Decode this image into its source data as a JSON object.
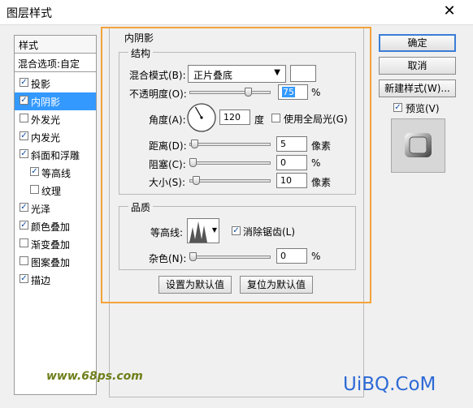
{
  "window": {
    "title": "图层样式"
  },
  "styles_list": {
    "header": "样式",
    "blend_options": "混合选项:自定",
    "items": [
      {
        "label": "投影",
        "checked": true,
        "selected": false,
        "indent": false
      },
      {
        "label": "内阴影",
        "checked": true,
        "selected": true,
        "indent": false
      },
      {
        "label": "外发光",
        "checked": false,
        "selected": false,
        "indent": false
      },
      {
        "label": "内发光",
        "checked": true,
        "selected": false,
        "indent": false
      },
      {
        "label": "斜面和浮雕",
        "checked": true,
        "selected": false,
        "indent": false
      },
      {
        "label": "等高线",
        "checked": true,
        "selected": false,
        "indent": true
      },
      {
        "label": "纹理",
        "checked": false,
        "selected": false,
        "indent": true
      },
      {
        "label": "光泽",
        "checked": true,
        "selected": false,
        "indent": false
      },
      {
        "label": "颜色叠加",
        "checked": true,
        "selected": false,
        "indent": false
      },
      {
        "label": "渐变叠加",
        "checked": false,
        "selected": false,
        "indent": false
      },
      {
        "label": "图案叠加",
        "checked": false,
        "selected": false,
        "indent": false
      },
      {
        "label": "描边",
        "checked": true,
        "selected": false,
        "indent": false
      }
    ]
  },
  "inner_shadow": {
    "section_title": "内阴影",
    "structure": {
      "title": "结构",
      "blend_mode_label": "混合模式(B):",
      "blend_mode_value": "正片叠底",
      "blend_color": "#ffffff",
      "opacity_label": "不透明度(O):",
      "opacity_value": "75",
      "opacity_unit": "%",
      "opacity_level": 0.75,
      "angle_label": "角度(A):",
      "angle_value": "120",
      "angle_unit": "度",
      "global_light_label": "使用全局光(G)",
      "global_light_checked": false,
      "distance_label": "距离(D):",
      "distance_value": "5",
      "distance_unit": "像素",
      "distance_level": 0.02,
      "choke_label": "阻塞(C):",
      "choke_value": "0",
      "choke_unit": "%",
      "choke_level": 0.0,
      "size_label": "大小(S):",
      "size_value": "10",
      "size_unit": "像素",
      "size_level": 0.04
    },
    "quality": {
      "title": "品质",
      "contour_label": "等高线:",
      "antialias_label": "消除锯齿(L)",
      "antialias_checked": true,
      "noise_label": "杂色(N):",
      "noise_value": "0",
      "noise_unit": "%",
      "noise_level": 0.0
    },
    "make_default": "设置为默认值",
    "reset_default": "复位为默认值"
  },
  "buttons": {
    "ok": "确定",
    "cancel": "取消",
    "new_style": "新建样式(W)...",
    "preview_label": "预览(V)",
    "preview_checked": true
  },
  "watermarks": {
    "left": "www.68ps.com",
    "right": "UiBQ.CoM"
  },
  "colors": {
    "selection": "#3399ff",
    "highlight_border": "#f2a33a",
    "ok_border": "#3b7dd8"
  }
}
